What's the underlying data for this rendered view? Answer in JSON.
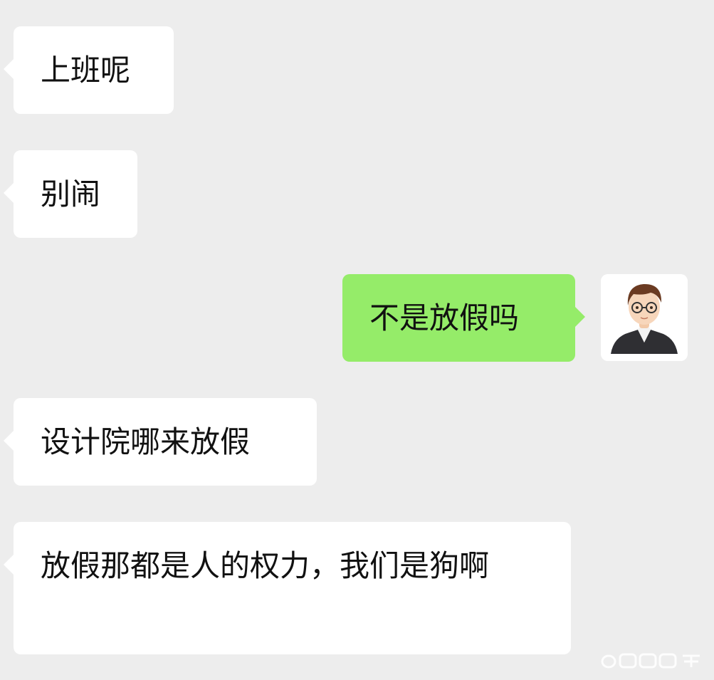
{
  "colors": {
    "background": "#ededed",
    "incoming_bubble": "#ffffff",
    "outgoing_bubble": "#95ec69",
    "text": "#111111"
  },
  "messages": [
    {
      "direction": "incoming",
      "text": "上班呢"
    },
    {
      "direction": "incoming",
      "text": "别闹"
    },
    {
      "direction": "outgoing",
      "text": "不是放假吗",
      "avatar_icon": "user-avatar-icon"
    },
    {
      "direction": "incoming",
      "text": "设计院哪来放假"
    },
    {
      "direction": "incoming",
      "text": "放假那都是人的权力，我们是狗啊"
    }
  ],
  "watermark": {
    "icon": "weibo-watermark-icon",
    "text": ""
  }
}
